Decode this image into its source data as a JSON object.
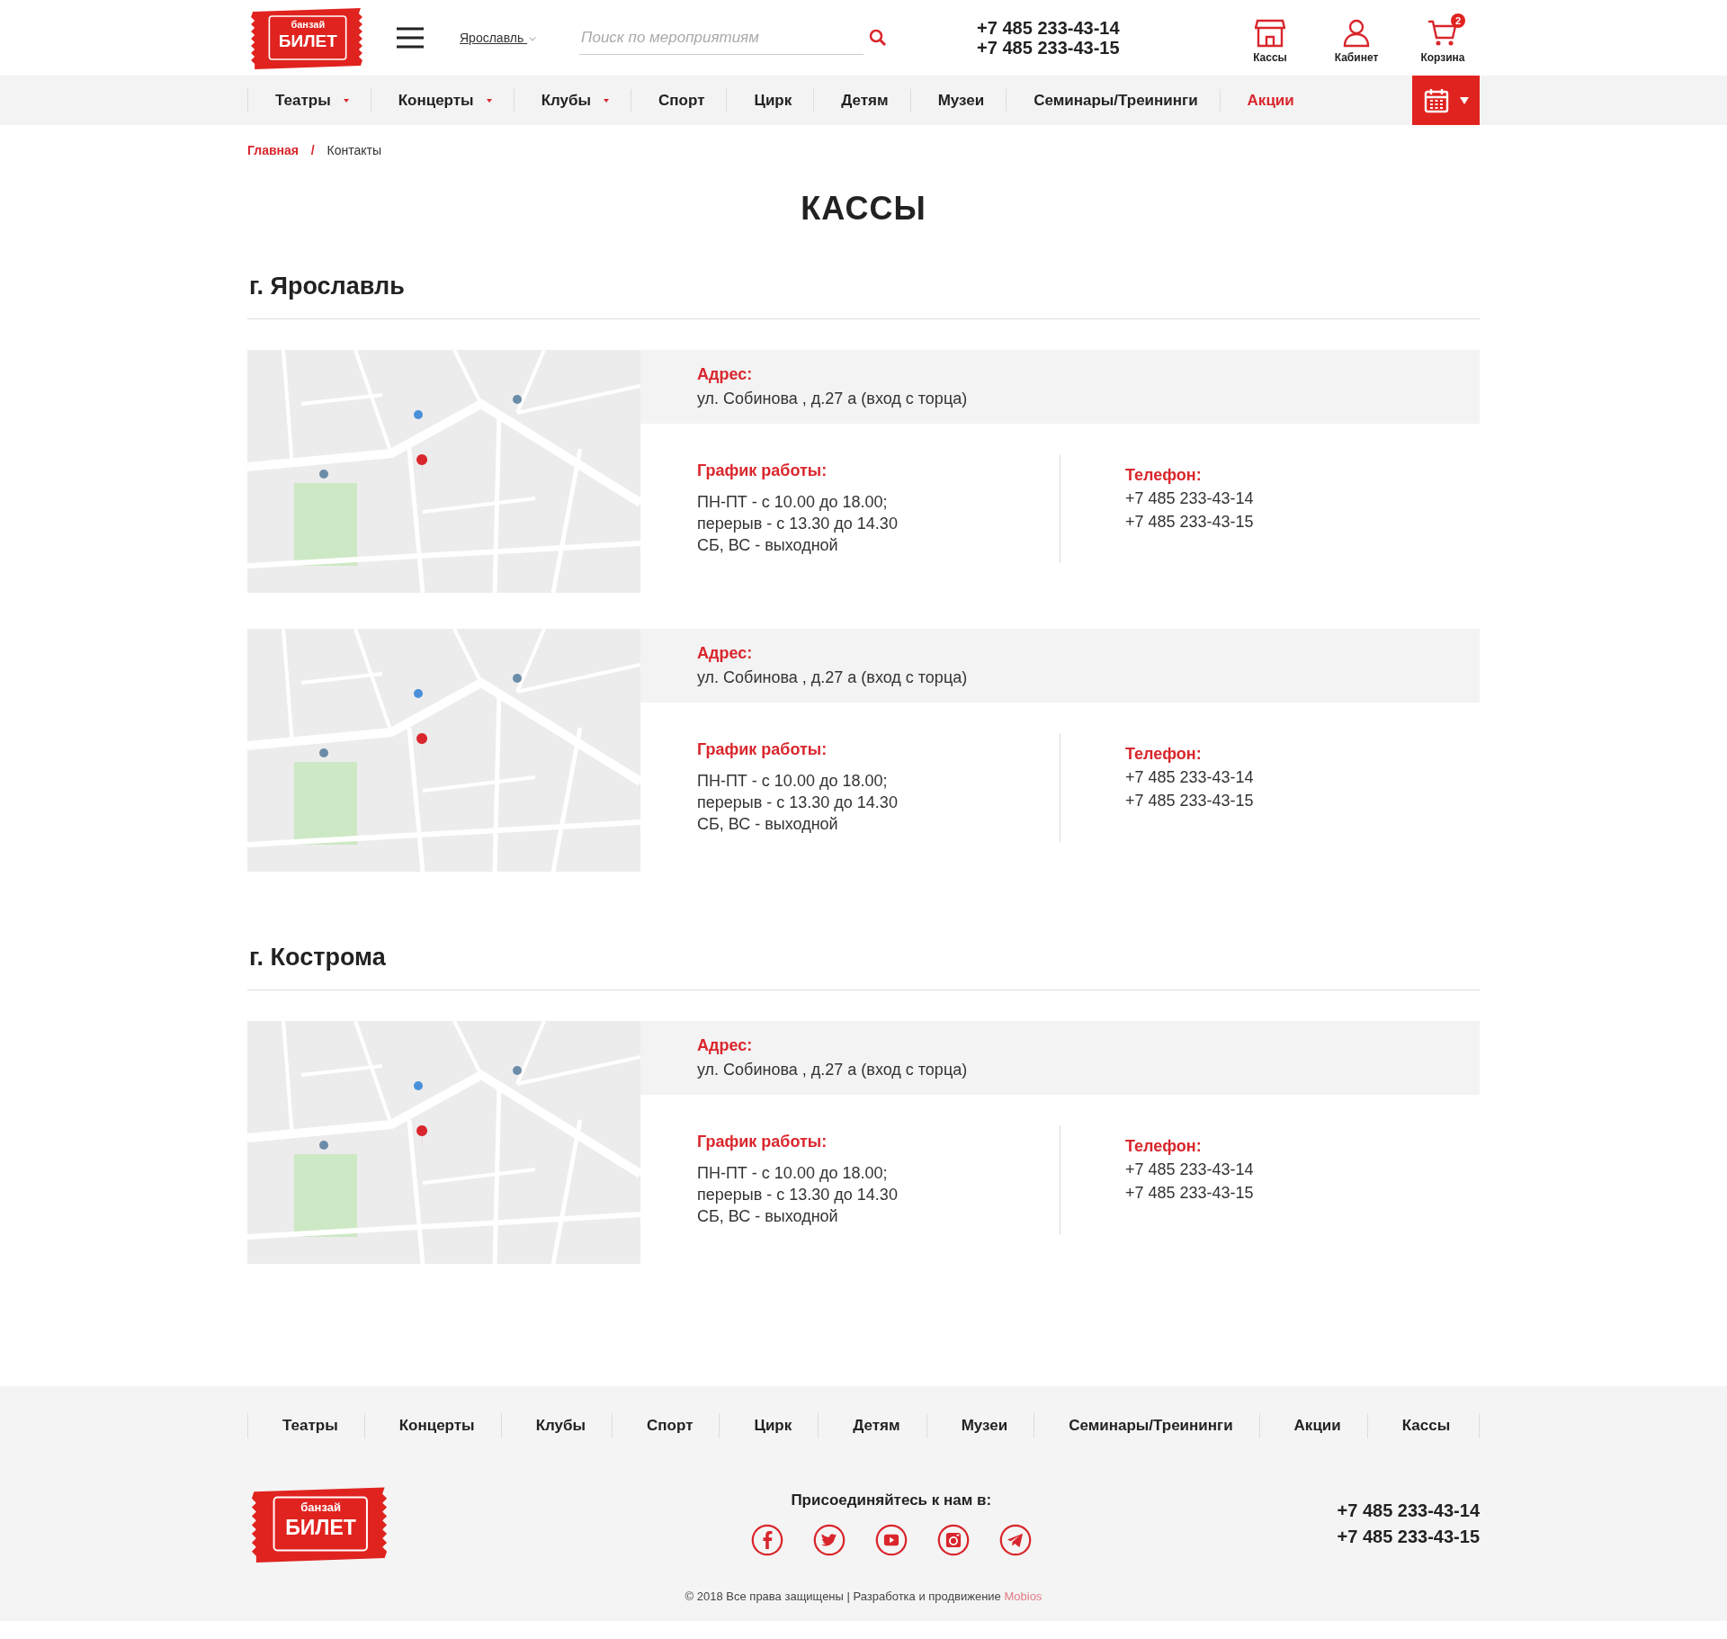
{
  "header": {
    "logo": {
      "brand_small": "банзай",
      "brand": "БИЛЕТ"
    },
    "city": "Ярославль",
    "search": {
      "placeholder": "Поиск по мероприятиям"
    },
    "phones": [
      "+7 485 233-43-14",
      "+7 485 233-43-15"
    ],
    "actions": [
      {
        "kind": "store",
        "label": "Кассы"
      },
      {
        "kind": "user",
        "label": "Кабинет"
      },
      {
        "kind": "cart",
        "label": "Корзина",
        "badge": "2"
      }
    ]
  },
  "nav": {
    "items": [
      {
        "label": "Театры",
        "dropdown": true,
        "highlighted": false
      },
      {
        "label": "Концерты",
        "dropdown": true,
        "highlighted": false
      },
      {
        "label": "Клубы",
        "dropdown": true,
        "highlighted": false
      },
      {
        "label": "Спорт",
        "dropdown": false,
        "highlighted": false
      },
      {
        "label": "Цирк",
        "dropdown": false,
        "highlighted": false
      },
      {
        "label": "Детям",
        "dropdown": false,
        "highlighted": false
      },
      {
        "label": "Музеи",
        "dropdown": false,
        "highlighted": false
      },
      {
        "label": "Семинары/Треининги",
        "dropdown": false,
        "highlighted": false
      },
      {
        "label": "Акции",
        "dropdown": false,
        "highlighted": true
      }
    ]
  },
  "breadcrumb": [
    {
      "label": "Главная",
      "link": true
    },
    {
      "label": "/",
      "link": true
    },
    {
      "label": "Контакты",
      "link": false
    }
  ],
  "title": "КАССЫ",
  "cities": [
    {
      "name": "г. Ярославль",
      "offices": [
        {
          "map": {
            "kind": "picture"
          },
          "address_label": "Адрес:",
          "address": "ул. Собинова , д.27 а (вход с торца)",
          "schedule_label": "График работы:",
          "schedule": [
            "ПН-ПТ - с 10.00 до 18.00;",
            "перерыв - с 13.30 до 14.30",
            "СБ, ВС - выходной"
          ],
          "phone_label": "Телефон:",
          "phones": [
            "+7 485 233-43-14",
            "+7 485 233-43-15"
          ]
        },
        {
          "map": {
            "kind": "picture"
          },
          "address_label": "Адрес:",
          "address": "ул. Собинова , д.27 а (вход с торца)",
          "schedule_label": "График работы:",
          "schedule": [
            "ПН-ПТ - с 10.00 до 18.00;",
            "перерыв - с 13.30 до 14.30",
            "СБ, ВС - выходной"
          ],
          "phone_label": "Телефон:",
          "phones": [
            "+7 485 233-43-14",
            "+7 485 233-43-15"
          ]
        }
      ]
    },
    {
      "name": "г. Кострома",
      "offices": [
        {
          "map": {
            "kind": "picture"
          },
          "address_label": "Адрес:",
          "address": "ул. Собинова , д.27 а (вход с торца)",
          "schedule_label": "График работы:",
          "schedule": [
            "ПН-ПТ - с 10.00 до 18.00;",
            "перерыв - с 13.30 до 14.30",
            "СБ, ВС - выходной"
          ],
          "phone_label": "Телефон:",
          "phones": [
            "+7 485 233-43-14",
            "+7 485 233-43-15"
          ]
        }
      ]
    }
  ],
  "footer": {
    "nav": [
      "Театры",
      "Концерты",
      "Клубы",
      "Спорт",
      "Цирк",
      "Детям",
      "Музеи",
      "Семинары/Треининги",
      "Акции",
      "Кассы"
    ],
    "logo": {
      "brand_small": "банзай",
      "brand": "БИЛЕТ"
    },
    "social_heading": "Присоединяйтесь к нам в:",
    "social": [
      {
        "kind": "facebook"
      },
      {
        "kind": "twitter"
      },
      {
        "kind": "youtube"
      },
      {
        "kind": "instagram"
      },
      {
        "kind": "telegram"
      }
    ],
    "phones": [
      "+7 485 233-43-14",
      "+7 485 233-43-15"
    ],
    "copyright": "© 2018 Все права защищены | Разработка и продвижение",
    "developer": "Mobios"
  }
}
